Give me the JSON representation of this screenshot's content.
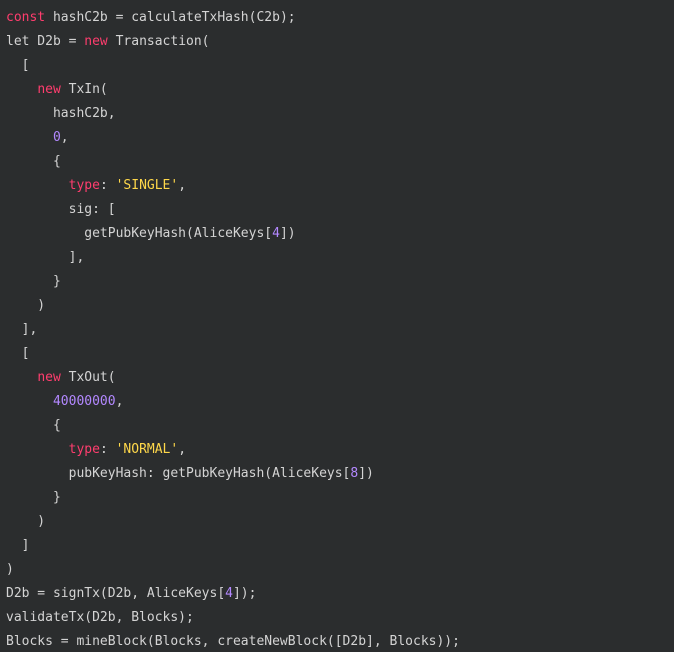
{
  "colors": {
    "background": "#2b2d2e",
    "text": "#d4d4d4",
    "keyword": "#ff3d6e",
    "number": "#b388ff",
    "string": "#ffd84a"
  },
  "code": {
    "lines": [
      [
        {
          "t": "const",
          "k": "keyword"
        },
        {
          "t": " hashC2b = calculateTxHash(C2b);",
          "k": "plain"
        }
      ],
      [
        {
          "t": "let D2b = ",
          "k": "plain"
        },
        {
          "t": "new",
          "k": "keyword"
        },
        {
          "t": " Transaction(",
          "k": "plain"
        }
      ],
      [
        {
          "t": "  [",
          "k": "plain"
        }
      ],
      [
        {
          "t": "    ",
          "k": "plain"
        },
        {
          "t": "new",
          "k": "keyword"
        },
        {
          "t": " TxIn(",
          "k": "plain"
        }
      ],
      [
        {
          "t": "      hashC2b,",
          "k": "plain"
        }
      ],
      [
        {
          "t": "      ",
          "k": "plain"
        },
        {
          "t": "0",
          "k": "number"
        },
        {
          "t": ",",
          "k": "plain"
        }
      ],
      [
        {
          "t": "      {",
          "k": "plain"
        }
      ],
      [
        {
          "t": "        ",
          "k": "plain"
        },
        {
          "t": "type",
          "k": "prop"
        },
        {
          "t": ": ",
          "k": "plain"
        },
        {
          "t": "'SINGLE'",
          "k": "string"
        },
        {
          "t": ",",
          "k": "plain"
        }
      ],
      [
        {
          "t": "        sig: [",
          "k": "plain"
        }
      ],
      [
        {
          "t": "          getPubKeyHash(AliceKeys[",
          "k": "plain"
        },
        {
          "t": "4",
          "k": "number"
        },
        {
          "t": "])",
          "k": "plain"
        }
      ],
      [
        {
          "t": "        ],",
          "k": "plain"
        }
      ],
      [
        {
          "t": "      }",
          "k": "plain"
        }
      ],
      [
        {
          "t": "    )",
          "k": "plain"
        }
      ],
      [
        {
          "t": "  ],",
          "k": "plain"
        }
      ],
      [
        {
          "t": "  [",
          "k": "plain"
        }
      ],
      [
        {
          "t": "    ",
          "k": "plain"
        },
        {
          "t": "new",
          "k": "keyword"
        },
        {
          "t": " TxOut(",
          "k": "plain"
        }
      ],
      [
        {
          "t": "      ",
          "k": "plain"
        },
        {
          "t": "40000000",
          "k": "number"
        },
        {
          "t": ",",
          "k": "plain"
        }
      ],
      [
        {
          "t": "      {",
          "k": "plain"
        }
      ],
      [
        {
          "t": "        ",
          "k": "plain"
        },
        {
          "t": "type",
          "k": "prop"
        },
        {
          "t": ": ",
          "k": "plain"
        },
        {
          "t": "'NORMAL'",
          "k": "string"
        },
        {
          "t": ",",
          "k": "plain"
        }
      ],
      [
        {
          "t": "        pubKeyHash: getPubKeyHash(AliceKeys[",
          "k": "plain"
        },
        {
          "t": "8",
          "k": "number"
        },
        {
          "t": "])",
          "k": "plain"
        }
      ],
      [
        {
          "t": "      }",
          "k": "plain"
        }
      ],
      [
        {
          "t": "    )",
          "k": "plain"
        }
      ],
      [
        {
          "t": "  ]",
          "k": "plain"
        }
      ],
      [
        {
          "t": ")",
          "k": "plain"
        }
      ],
      [
        {
          "t": "D2b = signTx(D2b, AliceKeys[",
          "k": "plain"
        },
        {
          "t": "4",
          "k": "number"
        },
        {
          "t": "]);",
          "k": "plain"
        }
      ],
      [
        {
          "t": "validateTx(D2b, Blocks);",
          "k": "plain"
        }
      ],
      [
        {
          "t": "Blocks = mineBlock(Blocks, createNewBlock([D2b], Blocks));",
          "k": "plain"
        }
      ]
    ]
  }
}
